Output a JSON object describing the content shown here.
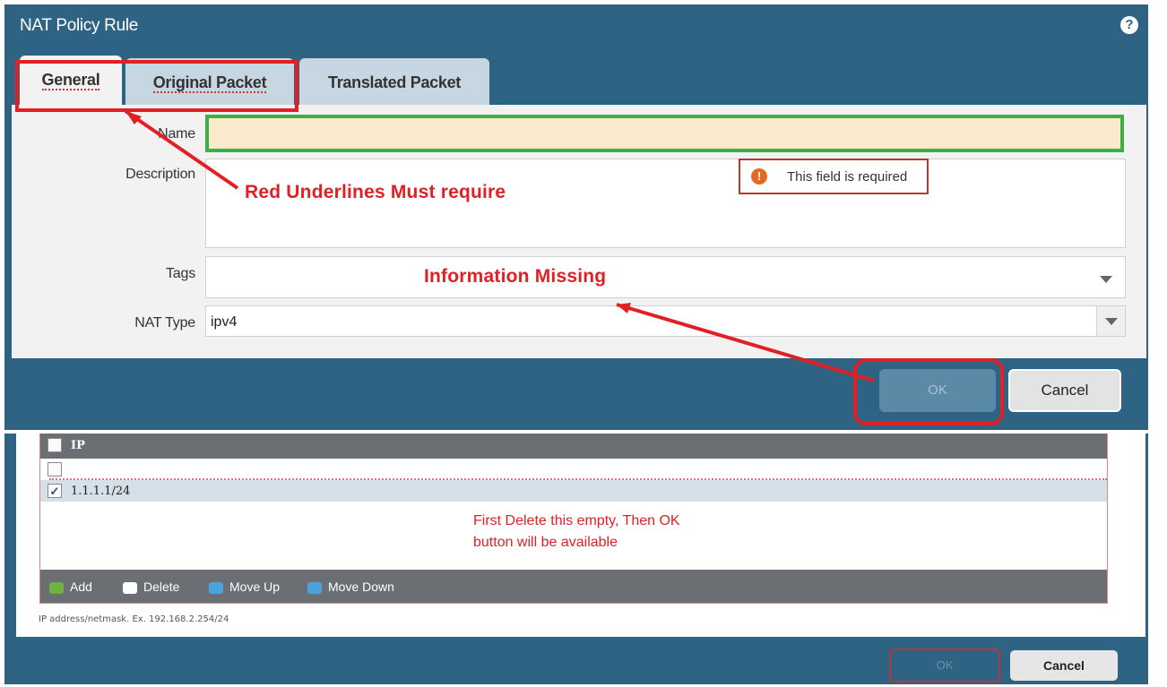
{
  "dialog_top": {
    "title": "NAT Policy Rule",
    "help_icon": "?",
    "tabs": [
      {
        "label": "General",
        "active": true
      },
      {
        "label": "Original Packet",
        "active": false
      },
      {
        "label": "Translated Packet",
        "active": false
      }
    ],
    "fields": {
      "name_label": "Name",
      "description_label": "Description",
      "tags_label": "Tags",
      "nat_type_label": "NAT Type",
      "nat_type_value": "ipv4"
    },
    "validation_message": "This field is required",
    "ok_label": "OK",
    "cancel_label": "Cancel"
  },
  "annotations": {
    "red_underlines": "Red Underlines Must require",
    "info_missing": "Information Missing",
    "first_delete_line1": "First Delete this empty, Then OK",
    "first_delete_line2": "button will be available"
  },
  "dialog_bottom": {
    "column_header": "IP",
    "rows": [
      {
        "value": "",
        "checked": false
      },
      {
        "value": "1.1.1.1/24",
        "checked": true
      }
    ],
    "toolbar": {
      "add": "Add",
      "delete": "Delete",
      "move_up": "Move Up",
      "move_down": "Move Down"
    },
    "hint": "IP address/netmask. Ex. 192.168.2.254/24",
    "ok_label": "OK",
    "cancel_label": "Cancel"
  },
  "colors": {
    "header_blue": "#2f6384",
    "annotation_red": "#e31f26",
    "required_green": "#3cb043",
    "name_field_bg": "#fbeacb"
  }
}
